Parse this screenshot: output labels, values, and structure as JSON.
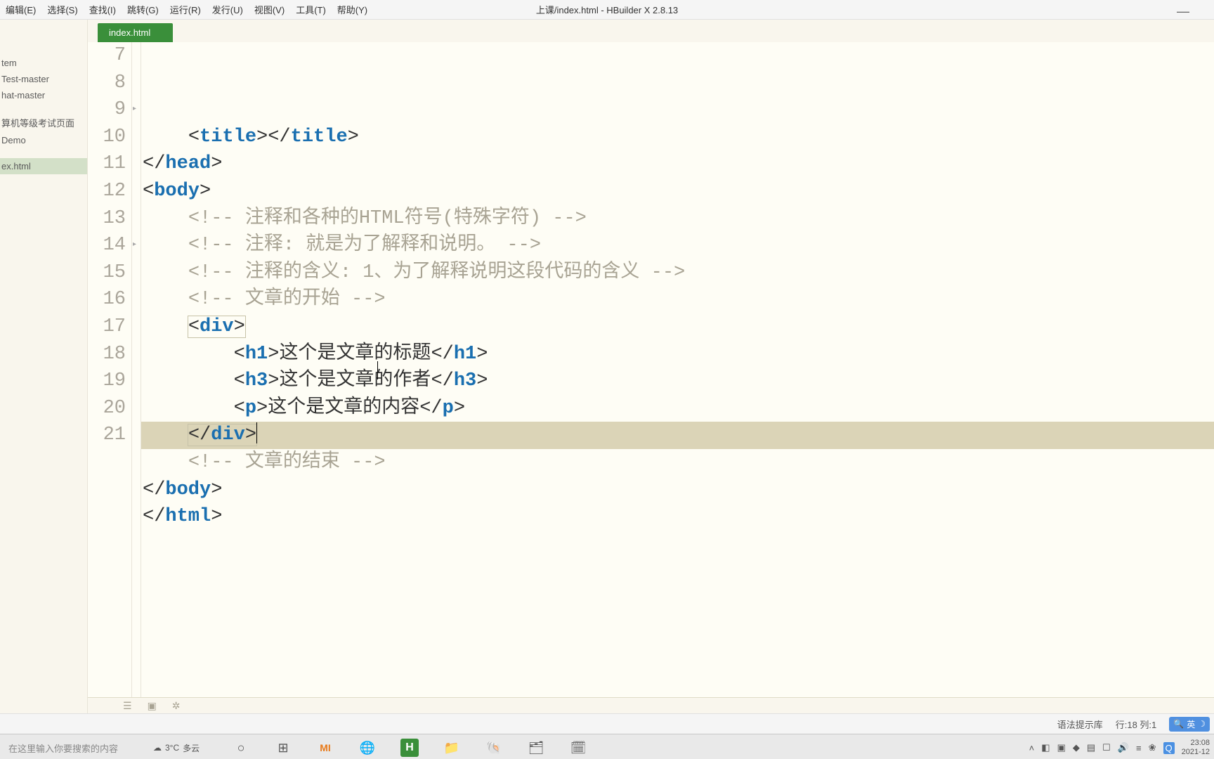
{
  "menu": {
    "items": [
      "编辑(E)",
      "选择(S)",
      "查找(I)",
      "跳转(G)",
      "运行(R)",
      "发行(U)",
      "视图(V)",
      "工具(T)",
      "帮助(Y)"
    ]
  },
  "title": "上课/index.html - HBuilder X 2.8.13",
  "sidebar": {
    "items": [
      "tem",
      "Test-master",
      "hat-master",
      "",
      "算机等级考试页面",
      "Demo",
      "",
      "ex.html"
    ],
    "selected_index": 7
  },
  "tab": {
    "label": "index.html"
  },
  "code": {
    "lines": [
      {
        "n": 7,
        "indent": 2,
        "parts": [
          [
            "angle",
            "<"
          ],
          [
            "tag",
            "title"
          ],
          [
            "angle",
            ">"
          ],
          [
            "angle",
            "</"
          ],
          [
            "tag",
            "title"
          ],
          [
            "angle",
            ">"
          ]
        ]
      },
      {
        "n": 8,
        "indent": 1,
        "parts": [
          [
            "angle",
            "</"
          ],
          [
            "tag",
            "head"
          ],
          [
            "angle",
            ">"
          ]
        ]
      },
      {
        "n": 9,
        "indent": 1,
        "fold": true,
        "parts": [
          [
            "angle",
            "<"
          ],
          [
            "tag",
            "body"
          ],
          [
            "angle",
            ">"
          ]
        ]
      },
      {
        "n": 10,
        "indent": 2,
        "parts": [
          [
            "comment",
            "<!-- 注释和各种的HTML符号(特殊字符) -->"
          ]
        ]
      },
      {
        "n": 11,
        "indent": 2,
        "parts": [
          [
            "comment",
            "<!-- 注释: 就是为了解释和说明。 -->"
          ]
        ]
      },
      {
        "n": 12,
        "indent": 2,
        "parts": [
          [
            "comment",
            "<!-- 注释的含义: 1、为了解释说明这段代码的含义 -->"
          ]
        ]
      },
      {
        "n": 13,
        "indent": 2,
        "parts": [
          [
            "comment",
            "<!-- 文章的开始 -->"
          ]
        ]
      },
      {
        "n": 14,
        "indent": 2,
        "fold": true,
        "boxed": true,
        "parts": [
          [
            "angle",
            "<"
          ],
          [
            "tag",
            "div"
          ],
          [
            "angle",
            ">"
          ]
        ]
      },
      {
        "n": 15,
        "indent": 3,
        "parts": [
          [
            "angle",
            "<"
          ],
          [
            "tag",
            "h1"
          ],
          [
            "angle",
            ">"
          ],
          [
            "text",
            "这个是文章的标题"
          ],
          [
            "angle",
            "</"
          ],
          [
            "tag",
            "h1"
          ],
          [
            "angle",
            ">"
          ]
        ]
      },
      {
        "n": 16,
        "indent": 3,
        "parts": [
          [
            "angle",
            "<"
          ],
          [
            "tag",
            "h3"
          ],
          [
            "angle",
            ">"
          ],
          [
            "text",
            "这个是文章的作者"
          ],
          [
            "angle",
            "</"
          ],
          [
            "tag",
            "h3"
          ],
          [
            "angle",
            ">"
          ]
        ]
      },
      {
        "n": 17,
        "indent": 3,
        "parts": [
          [
            "angle",
            "<"
          ],
          [
            "tag",
            "p"
          ],
          [
            "angle",
            ">"
          ],
          [
            "text",
            "这个是文章的内容"
          ],
          [
            "angle",
            "</"
          ],
          [
            "tag",
            "p"
          ],
          [
            "angle",
            ">"
          ]
        ]
      },
      {
        "n": 18,
        "indent": 2,
        "hl": true,
        "boxed": true,
        "cursor": true,
        "parts": [
          [
            "angle",
            "</"
          ],
          [
            "tag",
            "div"
          ],
          [
            "angle",
            ">"
          ]
        ]
      },
      {
        "n": 19,
        "indent": 2,
        "parts": [
          [
            "comment",
            "<!-- 文章的结束 -->"
          ]
        ]
      },
      {
        "n": 20,
        "indent": 1,
        "parts": [
          [
            "angle",
            "</"
          ],
          [
            "tag",
            "body"
          ],
          [
            "angle",
            ">"
          ]
        ]
      },
      {
        "n": 21,
        "indent": 1,
        "parts": [
          [
            "angle",
            "</"
          ],
          [
            "tag",
            "html"
          ],
          [
            "angle",
            ">"
          ]
        ]
      }
    ]
  },
  "status": {
    "hint": "语法提示库",
    "pos": "行:18 列:1",
    "ime": "英",
    "mode_icon": "☽"
  },
  "taskbar": {
    "search_placeholder": "在这里输入你要搜索的内容",
    "weather": {
      "temp": "3°C",
      "desc": "多云"
    },
    "clock": {
      "time": "23:08",
      "date": "2021-12"
    }
  }
}
